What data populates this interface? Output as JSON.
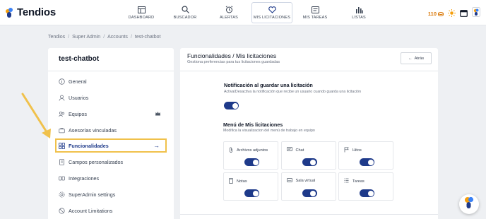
{
  "app": {
    "name": "Tendios"
  },
  "nav": [
    {
      "label": "DASHBOARD",
      "icon": "dashboard-icon"
    },
    {
      "label": "BUSCADOR",
      "icon": "search-icon"
    },
    {
      "label": "ALERTAS",
      "icon": "alarm-clock-icon"
    },
    {
      "label": "MIS LICITACIONES",
      "icon": "heart-icon",
      "active": true
    },
    {
      "label": "MIS TAREAS",
      "icon": "tasks-icon"
    },
    {
      "label": "LISTAS",
      "icon": "lists-icon"
    }
  ],
  "topright": {
    "coins": "110"
  },
  "breadcrumb": [
    "Tendios",
    "Super Admin",
    "Accounts",
    "test-chatbot"
  ],
  "left_panel": {
    "title": "test-chatbot",
    "items": [
      {
        "label": "General",
        "icon": "info-icon"
      },
      {
        "label": "Usuarios",
        "icon": "user-icon"
      },
      {
        "label": "Equipos",
        "icon": "team-icon"
      },
      {
        "label": "Asesorías vinculadas",
        "icon": "briefcase-icon"
      },
      {
        "label": "Funcionalidades",
        "icon": "grid-icon",
        "active": true
      },
      {
        "label": "Campos personalizados",
        "icon": "document-icon"
      },
      {
        "label": "Integraciones",
        "icon": "integrations-icon"
      },
      {
        "label": "SuperAdmin settings",
        "icon": "settings-icon"
      },
      {
        "label": "Account Limitations",
        "icon": "limit-icon"
      }
    ]
  },
  "right_panel": {
    "title": "Funcionalidades / Mis licitaciones",
    "subtitle": "Gestiona preferencias para tus licitaciones guardadas",
    "back_label": "Atrás",
    "notif": {
      "title": "Notificación al guardar una licitación",
      "desc": "Activa/Desactiva la notificación que recibe un usuario cuando guarda una licitación",
      "enabled": true
    },
    "menu": {
      "title": "Menú de Mis licitaciones",
      "desc": "Modifica la visualizacion del menú de trabajo en equipo",
      "cards": [
        {
          "label": "Archivos adjuntos",
          "icon": "paperclip-icon",
          "enabled": true
        },
        {
          "label": "Chat",
          "icon": "chat-icon",
          "enabled": true
        },
        {
          "label": "Hitos",
          "icon": "flag-icon",
          "enabled": true
        },
        {
          "label": "Notas",
          "icon": "note-icon",
          "enabled": true
        },
        {
          "label": "Sala virtual",
          "icon": "video-icon",
          "enabled": true
        },
        {
          "label": "Tareas",
          "icon": "checklist-icon",
          "enabled": true
        }
      ]
    }
  },
  "colors": {
    "accent": "#1e3a8a",
    "highlight": "#f0c14b",
    "brand_orange": "#d97706"
  }
}
